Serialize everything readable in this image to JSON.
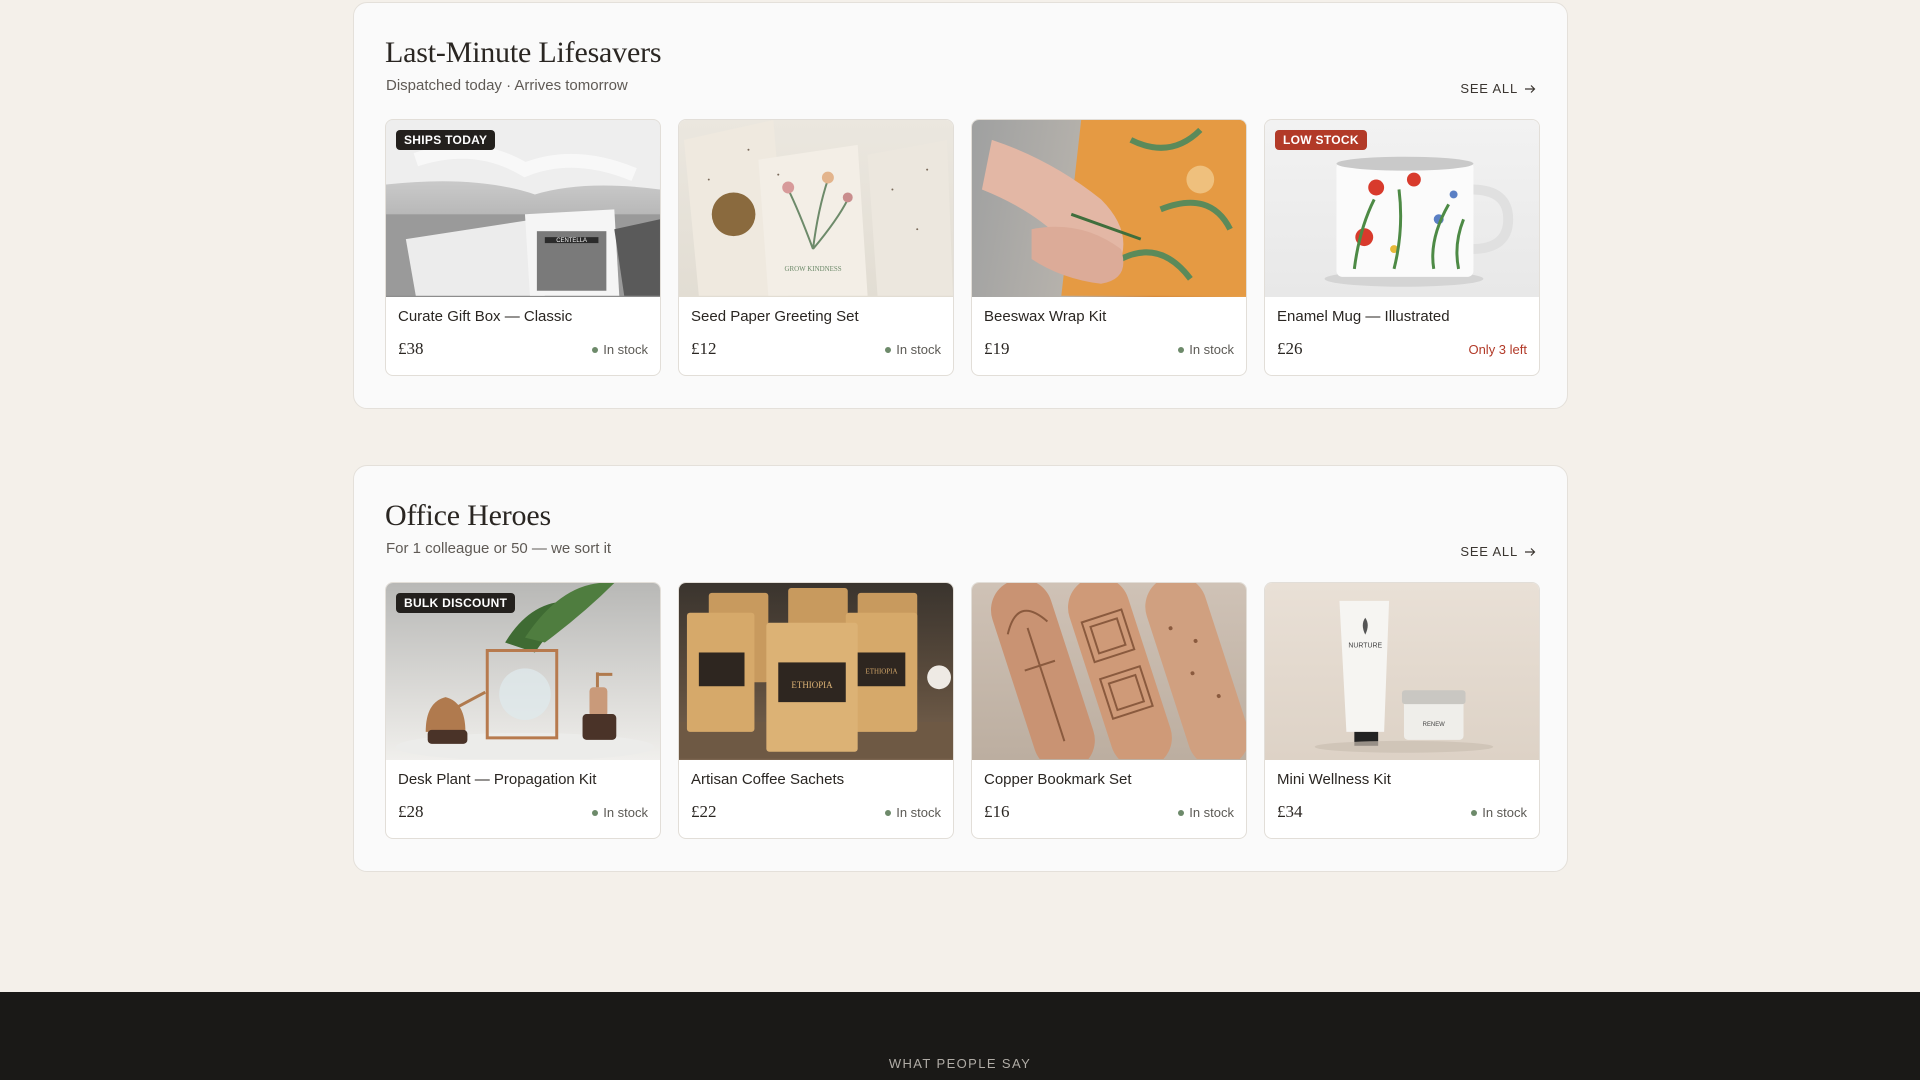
{
  "sections": [
    {
      "title": "Last-Minute Lifesavers",
      "subtitle": "Dispatched today · Arrives tomorrow",
      "see_all": "SEE ALL",
      "products": [
        {
          "name": "Curate Gift Box — Classic",
          "price": "£38",
          "stock": "In stock",
          "badge": "SHIPS TODAY",
          "badge_color": "#23201d"
        },
        {
          "name": "Seed Paper Greeting Set",
          "price": "£12",
          "stock": "In stock",
          "badge": ""
        },
        {
          "name": "Beeswax Wrap Kit",
          "price": "£19",
          "stock": "In stock",
          "badge": ""
        },
        {
          "name": "Enamel Mug — Illustrated",
          "price": "£26",
          "stock": "Only 3 left",
          "badge": "LOW STOCK",
          "badge_color": "#b23a28"
        }
      ]
    },
    {
      "title": "Office Heroes",
      "subtitle": "For 1 colleague or 50 — we sort it",
      "see_all": "SEE ALL",
      "products": [
        {
          "name": "Desk Plant — Propagation Kit",
          "price": "£28",
          "stock": "In stock",
          "badge": "BULK DISCOUNT",
          "badge_color": "#23201d"
        },
        {
          "name": "Artisan Coffee Sachets",
          "price": "£22",
          "stock": "In stock",
          "badge": ""
        },
        {
          "name": "Copper Bookmark Set",
          "price": "£16",
          "stock": "In stock",
          "badge": ""
        },
        {
          "name": "Mini Wellness Kit",
          "price": "£34",
          "stock": "In stock",
          "badge": ""
        }
      ]
    }
  ],
  "footer": {
    "eyebrow": "WHAT PEOPLE SAY"
  },
  "colors": {
    "background": "#f4f0ea",
    "in_stock_dot": "#6d8a6a",
    "low_stock": "#b23a28",
    "footer": "#1a1917"
  },
  "image_labels": {
    "gift_box": "CENTELLA",
    "card": "GROW KINDNESS",
    "coffee": "ETHIOPIA",
    "tube": "NURTURE",
    "jar": "RENEW"
  },
  "icons": {
    "see_all": "arrow-right-icon",
    "stock": "status-dot-icon"
  }
}
